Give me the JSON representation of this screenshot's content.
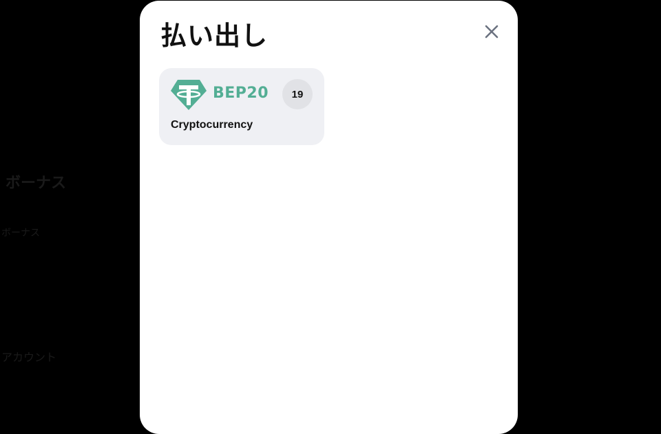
{
  "background": {
    "text_1": "ボーナス",
    "text_2": "ボーナス",
    "text_3": "アカウント"
  },
  "modal": {
    "title": "払い出し",
    "close_icon": "close-icon"
  },
  "methods": [
    {
      "icon": "tether-usdt-icon",
      "network": "BEP20",
      "count": "19",
      "name": "Cryptocurrency"
    }
  ],
  "colors": {
    "backdrop": "#000000",
    "modal_bg": "#ffffff",
    "card_bg": "#eff0f4",
    "badge_bg": "#e1e2e6",
    "tether_green": "#53ae94",
    "title_text": "#111111",
    "close_icon": "#6b7280"
  }
}
